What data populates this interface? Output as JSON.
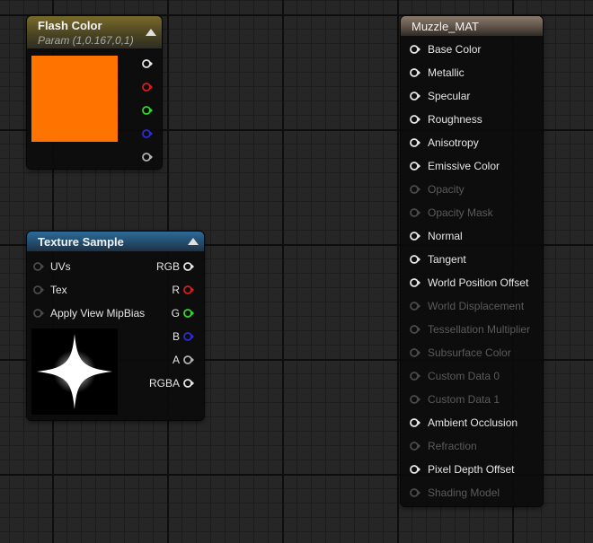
{
  "flash_color": {
    "title": "Flash Color",
    "subtitle": "Param (1,0.167,0,1)",
    "swatch_color": "#ff7400",
    "pins": [
      {
        "name": "rgba",
        "color": "#e6e6e6"
      },
      {
        "name": "r",
        "color": "#dd1b1b"
      },
      {
        "name": "g",
        "color": "#2fd82f"
      },
      {
        "name": "b",
        "color": "#2c2cd9"
      },
      {
        "name": "a",
        "color": "#b0b0b0"
      }
    ]
  },
  "texture_sample": {
    "title": "Texture Sample",
    "inputs": [
      "UVs",
      "Tex",
      "Apply View MipBias"
    ],
    "outputs": [
      {
        "label": "RGB",
        "color": "#e6e6e6"
      },
      {
        "label": "R",
        "color": "#dd1b1b"
      },
      {
        "label": "G",
        "color": "#2fd82f"
      },
      {
        "label": "B",
        "color": "#2c2cd9"
      },
      {
        "label": "A",
        "color": "#b0b0b0"
      },
      {
        "label": "RGBA",
        "color": "#e6e6e6"
      }
    ]
  },
  "material": {
    "title": "Muzzle_MAT",
    "inputs": [
      {
        "label": "Base Color",
        "enabled": true
      },
      {
        "label": "Metallic",
        "enabled": true
      },
      {
        "label": "Specular",
        "enabled": true
      },
      {
        "label": "Roughness",
        "enabled": true
      },
      {
        "label": "Anisotropy",
        "enabled": true
      },
      {
        "label": "Emissive Color",
        "enabled": true
      },
      {
        "label": "Opacity",
        "enabled": false
      },
      {
        "label": "Opacity Mask",
        "enabled": false
      },
      {
        "label": "Normal",
        "enabled": true
      },
      {
        "label": "Tangent",
        "enabled": true
      },
      {
        "label": "World Position Offset",
        "enabled": true
      },
      {
        "label": "World Displacement",
        "enabled": false
      },
      {
        "label": "Tessellation Multiplier",
        "enabled": false
      },
      {
        "label": "Subsurface Color",
        "enabled": false
      },
      {
        "label": "Custom Data 0",
        "enabled": false
      },
      {
        "label": "Custom Data 1",
        "enabled": false
      },
      {
        "label": "Ambient Occlusion",
        "enabled": true
      },
      {
        "label": "Refraction",
        "enabled": false
      },
      {
        "label": "Pixel Depth Offset",
        "enabled": true
      },
      {
        "label": "Shading Model",
        "enabled": false
      }
    ]
  }
}
